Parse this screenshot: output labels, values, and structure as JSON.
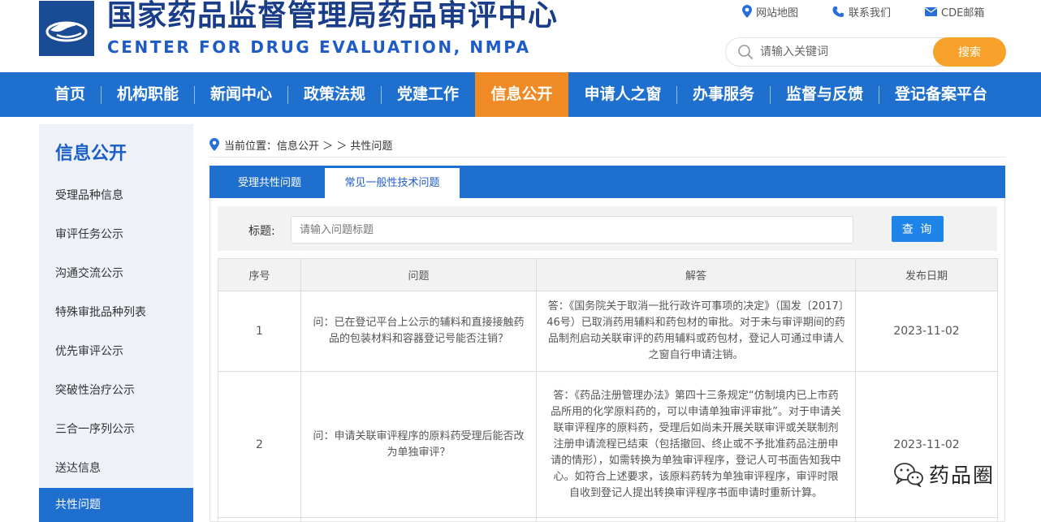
{
  "header": {
    "title_cn": "国家药品监督管理局药品审评中心",
    "title_en": "CENTER FOR DRUG EVALUATION, NMPA",
    "links": [
      {
        "label": "网站地图",
        "icon": "map-pin-icon"
      },
      {
        "label": "联系我们",
        "icon": "phone-icon"
      },
      {
        "label": "CDE邮箱",
        "icon": "mail-icon"
      }
    ],
    "search": {
      "placeholder": "请输入关键词",
      "button": "搜索"
    }
  },
  "nav": {
    "items": [
      "首页",
      "机构职能",
      "新闻中心",
      "政策法规",
      "党建工作",
      "信息公开",
      "申请人之窗",
      "办事服务",
      "监督与反馈",
      "登记备案平台"
    ],
    "active": "信息公开"
  },
  "sidebar": {
    "title": "信息公开",
    "items": [
      "受理品种信息",
      "审评任务公示",
      "沟通交流公示",
      "特殊审批品种列表",
      "优先审评公示",
      "突破性治疗公示",
      "三合一序列公示",
      "送达信息",
      "共性问题"
    ],
    "active": "共性问题"
  },
  "breadcrumb": {
    "text": "当前位置：信息公开 ＞ ＞ 共性问题"
  },
  "tabs": [
    "受理共性问题",
    "常见一般性技术问题"
  ],
  "active_tab": "常见一般性技术问题",
  "filter": {
    "label": "标题:",
    "placeholder": "请输入问题标题",
    "button": "查 询"
  },
  "table": {
    "headers": [
      "序号",
      "问题",
      "解答",
      "发布日期"
    ],
    "rows": [
      {
        "num": "1",
        "question": "问：已在登记平台上公示的辅料和直接接触药品的包装材料和容器登记号能否注销？",
        "answer": "答：《国务院关于取消一批行政许可事项的决定》（国发〔2017〕46号）已取消药用辅料和药包材的审批。对于未与审评期间的药品制剂启动关联审评的药用辅料或药包材，登记人可通过申请人之窗自行申请注销。",
        "date": "2023-11-02"
      },
      {
        "num": "2",
        "question": "问：申请关联审评程序的原料药受理后能否改为单独审评？",
        "answer": "答：《药品注册管理办法》第四十三条规定“仿制境内已上市药品所用的化学原料药的，可以申请单独审评审批”。对于申请关联审评程序的原料药，受理后如尚未开展关联审评或关联制剂注册申请流程已结束（包括撤回、终止或不予批准药品注册申请的情形），如需转换为单独审评程序，登记人可书面告知我中心。如符合上述要求，该原料药转为单独审评程序，审评时限自收到登记人提出转换审评程序书面申请时重新计算。",
        "date": "2023-11-02"
      }
    ]
  },
  "watermark": {
    "text": "药品圈",
    "icon": "wechat-icon"
  },
  "colors": {
    "primary": "#1e6fce",
    "accent": "#f08a24",
    "search_button": "#f7a12a",
    "sidebar_bg": "#eef2f8"
  }
}
